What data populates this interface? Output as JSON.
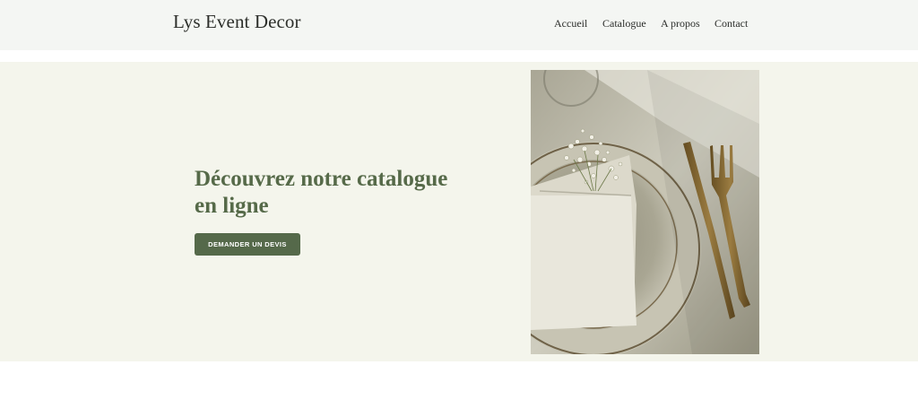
{
  "header": {
    "logo": "Lys Event Decor",
    "nav": [
      "Accueil",
      "Catalogue",
      "A propos",
      "Contact"
    ]
  },
  "hero": {
    "title_line1": "Découvrez notre catalogue",
    "title_line2": "en ligne",
    "cta_label": "DEMANDER UN DEVIS",
    "image_icon": "table-setting-photo"
  },
  "colors": {
    "accent": "#55694a",
    "hero_bg": "#f4f5ec",
    "header_bg": "#f4f6f3"
  }
}
